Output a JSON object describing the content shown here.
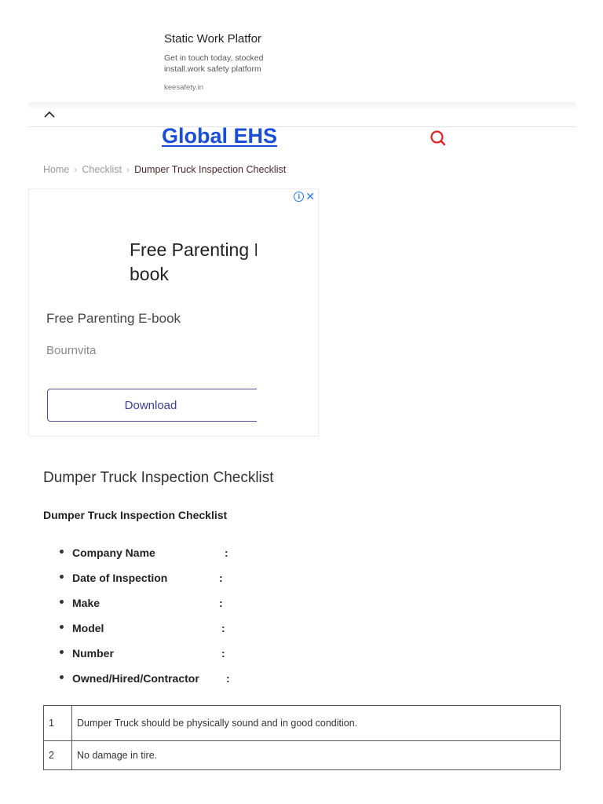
{
  "top_ad": {
    "title": "Static Work Platfor",
    "desc_line1": "Get in touch today, stocked",
    "desc_line2": "install.work safety platform",
    "domain": "keesafety.in"
  },
  "header": {
    "site_title": "Global EHS",
    "icons": {
      "collapse": "chevron-up-icon",
      "search": "search-icon"
    },
    "colors": {
      "title": "#1a4ed8",
      "search": "#e02424"
    }
  },
  "breadcrumb": {
    "items": [
      "Home",
      "Checklist"
    ],
    "current": "Dumper Truck Inspection Checklist"
  },
  "mid_ad": {
    "headline_line1": "Free Parenting E",
    "headline_line2": "book",
    "subtitle": "Free Parenting E-book",
    "brand": "Bournvita",
    "button_label": "Download",
    "choices_icon": "ad-info-icon",
    "close_icon": "close-icon"
  },
  "article": {
    "title": "Dumper Truck Inspection Checklist",
    "subtitle": "Dumper Truck Inspection Checklist",
    "fields": [
      {
        "label": "Company Name",
        "colon": ":"
      },
      {
        "label": "Date of Inspection",
        "colon": ":"
      },
      {
        "label": "Make",
        "colon": ":"
      },
      {
        "label": "Model",
        "colon": ":"
      },
      {
        "label": "Number",
        "colon": ":"
      },
      {
        "label": "Owned/Hired/Contractor",
        "colon": ":"
      }
    ],
    "table": {
      "rows": [
        {
          "num": "1",
          "text": "Dumper Truck should be physically sound and in good condition."
        },
        {
          "num": "2",
          "text": "No damage in tire."
        }
      ]
    }
  }
}
